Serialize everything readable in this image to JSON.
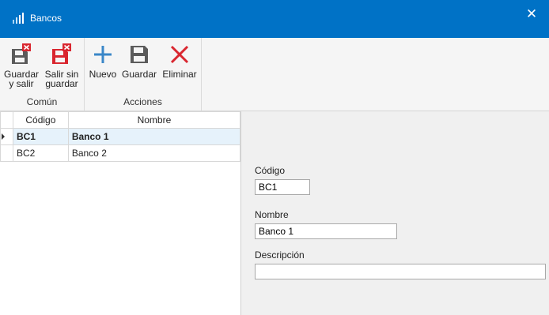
{
  "window": {
    "title": "Bancos",
    "app_icon": "bar-chart-icon",
    "close_icon": "close-icon"
  },
  "ribbon": {
    "groups": [
      {
        "label": "Común",
        "buttons": [
          {
            "label": "Guardar\ny salir",
            "icon": "save-close-icon"
          },
          {
            "label": "Salir sin\nguardar",
            "icon": "discard-close-icon"
          }
        ]
      },
      {
        "label": "Acciones",
        "buttons": [
          {
            "label": "Nuevo",
            "icon": "plus-icon"
          },
          {
            "label": "Guardar",
            "icon": "save-icon"
          },
          {
            "label": "Eliminar",
            "icon": "delete-icon"
          }
        ]
      }
    ]
  },
  "grid": {
    "columns": [
      "Código",
      "Nombre"
    ],
    "rows": [
      {
        "codigo": "BC1",
        "nombre": "Banco 1"
      },
      {
        "codigo": "BC2",
        "nombre": "Banco 2"
      }
    ],
    "selected_row": 0
  },
  "form": {
    "codigo": {
      "label": "Código",
      "value": "BC1"
    },
    "nombre": {
      "label": "Nombre",
      "value": "Banco 1"
    },
    "descripcion": {
      "label": "Descripción",
      "value": ""
    }
  },
  "colors": {
    "titlebar": "#0072c6",
    "icon_red": "#d9262f",
    "icon_blue": "#3a87c8",
    "icon_gray": "#555555"
  }
}
